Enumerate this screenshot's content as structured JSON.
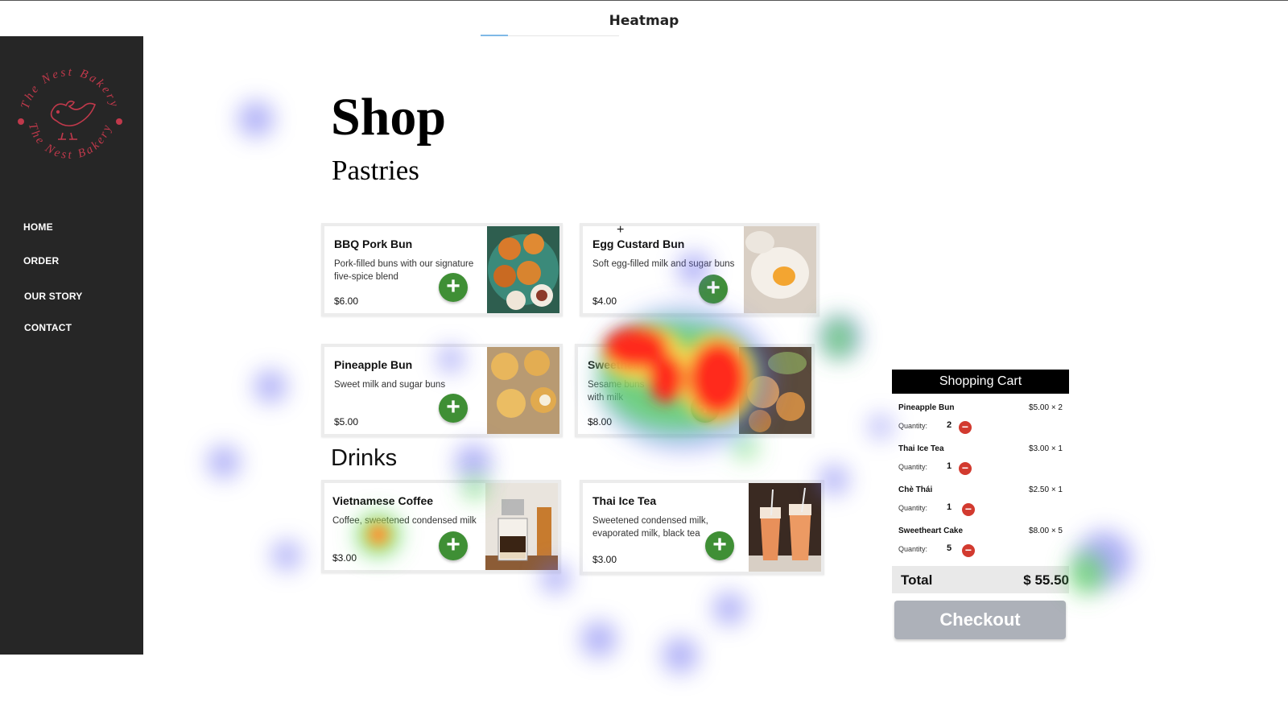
{
  "topbar": {
    "title": "Heatmap"
  },
  "sidebar": {
    "logo_text_top": "The Nest Bakery",
    "logo_text_bottom": "The Nest Bakery",
    "nav": [
      {
        "label": "HOME"
      },
      {
        "label": "ORDER"
      },
      {
        "label": "OUR STORY"
      },
      {
        "label": "CONTACT"
      }
    ]
  },
  "main": {
    "title": "Shop",
    "pastries_heading": "Pastries",
    "drinks_heading": "Drinks",
    "products": [
      {
        "name": "BBQ Pork Bun",
        "description": "Pork-filled buns with our signature five-spice blend",
        "price": "$6.00",
        "add_icon": "plus-icon"
      },
      {
        "name": "Egg Custard Bun",
        "description": "Soft egg-filled milk and sugar buns",
        "price": "$4.00",
        "add_icon": "plus-icon"
      },
      {
        "name": "Pineapple Bun",
        "description": "Sweet milk and sugar buns",
        "price": "$5.00",
        "add_icon": "plus-icon"
      },
      {
        "name": "Sweetheart Cake",
        "description": "Sesame buns with milk",
        "price": "$8.00",
        "add_icon": "plus-icon"
      },
      {
        "name": "Vietnamese Coffee",
        "description": "Coffee, sweetened condensed milk",
        "price": "$3.00",
        "add_icon": "plus-icon"
      },
      {
        "name": "Thai Ice Tea",
        "description": "Sweetened condensed milk, evaporated milk, black tea",
        "price": "$3.00",
        "add_icon": "plus-icon"
      }
    ]
  },
  "cart": {
    "title": "Shopping Cart",
    "quantity_label": "Quantity:",
    "items": [
      {
        "name": "Pineapple Bun",
        "price": "$5.00 × 2",
        "quantity": "2"
      },
      {
        "name": "Thai Ice Tea",
        "price": "$3.00 × 1",
        "quantity": "1"
      },
      {
        "name": "Chè Thái",
        "price": "$2.50 × 1",
        "quantity": "1"
      },
      {
        "name": "Sweetheart Cake",
        "price": "$8.00 × 5",
        "quantity": "5"
      }
    ],
    "total_label": "Total",
    "total_value": "$ 55.50",
    "checkout_label": "Checkout"
  },
  "colors": {
    "sidebar_bg": "#262626",
    "add_button": "#3f8f35",
    "remove_button": "#d23a2f",
    "checkout_button": "#adb1b9",
    "logo_accent": "#c0394b"
  }
}
